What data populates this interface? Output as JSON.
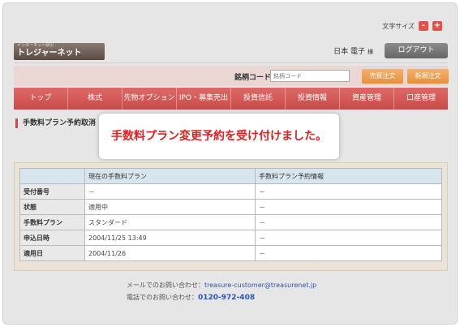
{
  "header": {
    "font_size_label": "文字サイズ",
    "font_minus": "-",
    "font_plus": "+",
    "logo_small": "インターネット取引",
    "logo_main": "トレジャーネット",
    "user_name": "日本 電子",
    "user_suffix": "様",
    "logout_label": "ログアウト"
  },
  "ticker": {
    "label": "銘柄コード",
    "placeholder": "銘柄コード",
    "sell_buy_label": "売買注文",
    "new_order_label": "新規注文"
  },
  "nav": {
    "items": [
      "トップ",
      "株式",
      "先物オプション",
      "IPO・募集売出",
      "投資信託",
      "投資情報",
      "資産管理",
      "口座管理"
    ]
  },
  "section_title": "手数料プラン予約取消",
  "popup_message": "手数料プラン変更予約を受け付けました。",
  "table": {
    "headers": [
      "",
      "現在の手数料プラン",
      "手数料プラン予約情報"
    ],
    "rows": [
      {
        "label": "受付番号",
        "current": "－",
        "reserved": "－"
      },
      {
        "label": "状態",
        "current": "適用中",
        "reserved": "－"
      },
      {
        "label": "手数料プラン",
        "current": "スタンダード",
        "reserved": "－"
      },
      {
        "label": "申込日時",
        "current": "2004/11/25 13:49",
        "reserved": "－"
      },
      {
        "label": "適用日",
        "current": "2004/11/26",
        "reserved": "－"
      }
    ]
  },
  "contact": {
    "mail_prefix": "メールでのお問い合わせ：",
    "mail": "treasure-customer@treasurenet.jp",
    "tel_prefix": "電話でのお問い合わせ：",
    "tel": "0120-972-408"
  },
  "colors": {
    "nav_red": "#c94a48",
    "order_orange": "#e88f3a",
    "popup_text": "#e02020",
    "link_blue": "#2b55b8"
  }
}
